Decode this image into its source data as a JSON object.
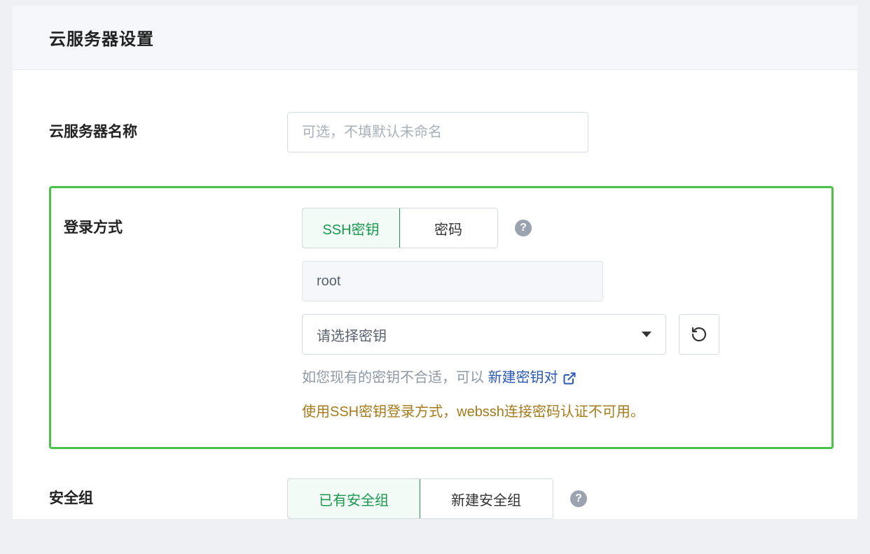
{
  "header": {
    "title": "云服务器设置"
  },
  "server_name": {
    "label": "云服务器名称",
    "placeholder": "可选，不填默认未命名",
    "value": ""
  },
  "login_method": {
    "label": "登录方式",
    "options": {
      "ssh_key": "SSH密钥",
      "password": "密码"
    },
    "selected": "ssh_key",
    "username": "root",
    "key_select_placeholder": "请选择密钥",
    "hint_prefix": "如您现有的密钥不合适，可以 ",
    "create_key_link": "新建密钥对",
    "warning": "使用SSH密钥登录方式，webssh连接密码认证不可用。"
  },
  "security_group": {
    "label": "安全组",
    "options": {
      "existing": "已有安全组",
      "create_new": "新建安全组"
    },
    "selected": "existing"
  },
  "icons": {
    "help": "?",
    "refresh": "refresh-icon",
    "external": "external-link-icon",
    "chevron_down": "chevron-down-icon"
  }
}
